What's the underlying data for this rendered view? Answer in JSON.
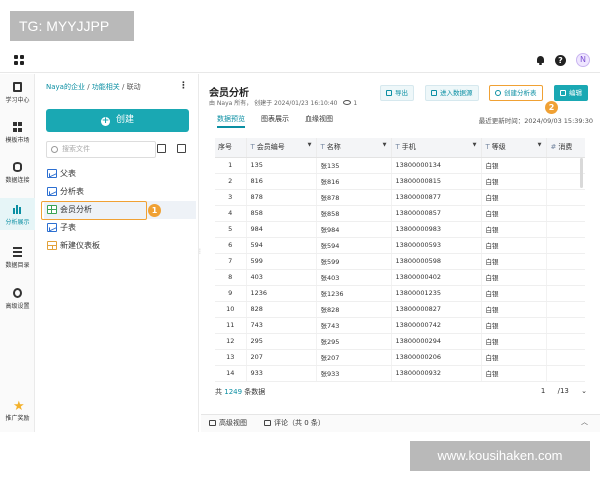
{
  "overlay": {
    "tg": "TG: MYYJJPP",
    "site": "www.kousihaken.com"
  },
  "topbar": {
    "avatar_letter": "N"
  },
  "leftnav": [
    {
      "label": "学习中心"
    },
    {
      "label": "模板市场"
    },
    {
      "label": "数据连接"
    },
    {
      "label": "分析展示"
    },
    {
      "label": "数据目录"
    },
    {
      "label": "高级设置"
    },
    {
      "label": "推广奖励"
    }
  ],
  "filepanel": {
    "breadcrumb": {
      "part1": "Naya的企业",
      "sep1": " / ",
      "part2": "功能相关",
      "sep2": " / ",
      "part3": "联动"
    },
    "more": "⋮",
    "create_label": "创建",
    "search_placeholder": "搜索文件",
    "tree": [
      {
        "label": "父表",
        "icon": "line-chart-icon"
      },
      {
        "label": "分析表",
        "icon": "line-chart-icon"
      },
      {
        "label": "会员分析",
        "icon": "table-icon"
      },
      {
        "label": "子表",
        "icon": "line-chart-icon"
      },
      {
        "label": "新建仪表板",
        "icon": "dashboard-icon"
      }
    ],
    "badge1": "1"
  },
  "main": {
    "title": "会员分析",
    "meta": "由 Naya 所有，  创建于 2024/01/23 16:10:40",
    "views": "1",
    "actions": {
      "export": "导出",
      "enter_source": "进入数据源",
      "create_analysis": "创建分析表",
      "edit": "编辑"
    },
    "badge2": "2",
    "tabs": [
      "数据预览",
      "图表展示",
      "血缘视图"
    ],
    "updated": "最近更新时间：2024/09/03 15:39:30",
    "columns": [
      {
        "label": "序号",
        "tag": ""
      },
      {
        "label": "会员编号",
        "tag": "T"
      },
      {
        "label": "名称",
        "tag": "T"
      },
      {
        "label": "手机",
        "tag": "T"
      },
      {
        "label": "等级",
        "tag": "T"
      },
      {
        "label": "消费",
        "tag": "#"
      }
    ],
    "rows": [
      [
        "1",
        "135",
        "张135",
        "13800000134",
        "白银"
      ],
      [
        "2",
        "816",
        "张816",
        "13800000815",
        "白银"
      ],
      [
        "3",
        "878",
        "张878",
        "13800000877",
        "白银"
      ],
      [
        "4",
        "858",
        "张858",
        "13800000857",
        "白银"
      ],
      [
        "5",
        "984",
        "张984",
        "13800000983",
        "白银"
      ],
      [
        "6",
        "594",
        "张594",
        "13800000593",
        "白银"
      ],
      [
        "7",
        "599",
        "张599",
        "13800000598",
        "白银"
      ],
      [
        "8",
        "403",
        "张403",
        "13800000402",
        "白银"
      ],
      [
        "9",
        "1236",
        "张1236",
        "13800001235",
        "白银"
      ],
      [
        "10",
        "828",
        "张828",
        "13800000827",
        "白银"
      ],
      [
        "11",
        "743",
        "张743",
        "13800000742",
        "白银"
      ],
      [
        "12",
        "295",
        "张295",
        "13800000294",
        "白银"
      ],
      [
        "13",
        "207",
        "张207",
        "13800000206",
        "白银"
      ],
      [
        "14",
        "933",
        "张933",
        "13800000932",
        "白银"
      ]
    ],
    "pager": {
      "prefix": "共",
      "count": "1249",
      "suffix": "条数据",
      "page": "1",
      "total": "/13"
    }
  },
  "footer": {
    "advanced_view": "高级视图",
    "comments": "评论（共 0 条）"
  }
}
